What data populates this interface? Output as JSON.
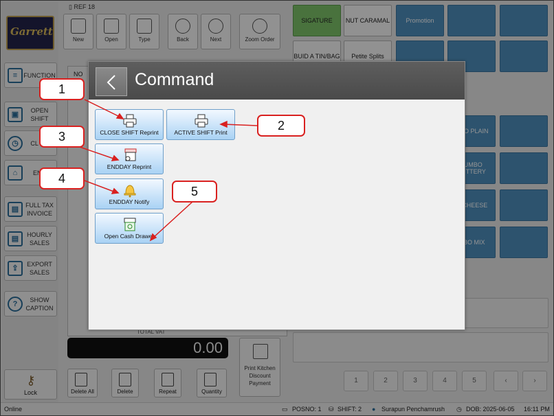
{
  "ref_label": "REF 18",
  "left_buttons": {
    "function": "FUNCTION",
    "open_shift": "OPEN SHIFT",
    "close_shift": "CL SH",
    "endday": "END",
    "full_tax_invoice": "FULL TAX INVOICE",
    "hourly_sales": "HOURLY SALES",
    "export_sales": "EXPORT SALES",
    "show_caption": "SHOW CAPTION",
    "lock": "Lock"
  },
  "logo_text": "Garrett",
  "toolbar": {
    "new": "New",
    "open": "Open",
    "type": "Type",
    "back": "Back",
    "next": "Next",
    "zoom_order": "Zoom Order"
  },
  "order": {
    "col_no": "NO",
    "total_vat_label": "TOTAL VAT",
    "total_amount": "0.00"
  },
  "bottom_buttons": {
    "delete_all": "Delete All",
    "delete": "Delete",
    "repeat": "Repeat",
    "quantity": "Quantity",
    "print_kitchen": "Print Kitchen Discount Payment"
  },
  "category_tabs": [
    "SIGATURE",
    "NUT CARAMAL",
    "Promotion",
    "",
    ""
  ],
  "category_row2": [
    "BUID A TIN/BAG",
    "Petite Splits",
    "",
    "",
    ""
  ],
  "products": [
    "MBO PLAIN",
    "JUMBO BUTTERY",
    "O CHEESE",
    "MBO MIX"
  ],
  "pager": [
    "1",
    "2",
    "3",
    "4",
    "5"
  ],
  "dialog": {
    "title": "Command",
    "buttons": {
      "close_shift_reprint": "CLOSE SHIFT Reprint",
      "active_shift_print": "ACTIVE SHIFT Print",
      "endday_reprint": "ENDDAY Reprint",
      "endday_notify": "ENDDAY Notify",
      "open_cash_drawer": "Open Cash Drawer"
    }
  },
  "callouts": [
    "1",
    "2",
    "3",
    "4",
    "5"
  ],
  "status": {
    "connection": "Online",
    "posno": "POSNO: 1",
    "shift": "SHIFT: 2",
    "user": "Surapun Penchamrush",
    "dob": "DOB: 2025-06-05",
    "time": "16:11 PM"
  },
  "colors": {
    "accent_blue": "#4e8fbe",
    "callout_red": "#d9201f",
    "dialog_header": "#4a4a4a",
    "signature_green": "#7ec46a"
  }
}
